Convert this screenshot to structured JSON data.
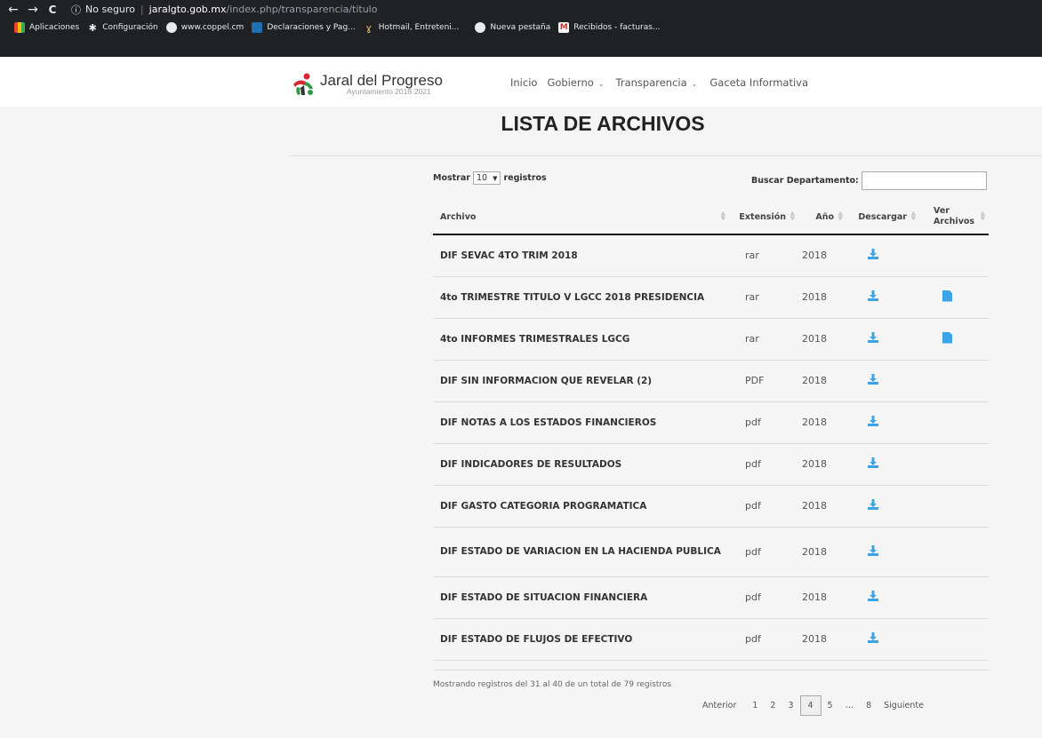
{
  "browser": {
    "back": "←",
    "forward": "→",
    "reload": "C",
    "security_label": "No seguro",
    "url_host": "jaralgto.gob.mx",
    "url_path": "/index.php/transparencia/titulo"
  },
  "bookmarks": [
    {
      "label": "Aplicaciones",
      "icon": "apps-grid-icon"
    },
    {
      "label": "Configuración",
      "icon": "gear-icon"
    },
    {
      "label": "www.coppel.cm",
      "icon": "globe-icon"
    },
    {
      "label": "Declaraciones y Pag...",
      "icon": "sat-icon"
    },
    {
      "label": "Hotmail, Entreteni...",
      "icon": "msn-icon"
    },
    {
      "label": "Nueva pestaña",
      "icon": "globe-icon"
    },
    {
      "label": "Recibidos - facturas...",
      "icon": "gmail-icon"
    }
  ],
  "site": {
    "logo_title": "Jaral del Progreso",
    "logo_sub": "Ayuntamiento 2018-2021",
    "nav": [
      {
        "label": "Inicio",
        "dropdown": false
      },
      {
        "label": "Gobierno",
        "dropdown": true
      },
      {
        "label": "Transparencia",
        "dropdown": true
      },
      {
        "label": "Gaceta Informativa",
        "dropdown": false
      }
    ]
  },
  "page_title": "LISTA DE ARCHIVOS",
  "controls": {
    "show_prefix": "Mostrar",
    "show_value": "10",
    "show_suffix": "registros",
    "search_label": "Buscar Departamento:",
    "search_value": ""
  },
  "table": {
    "headers": [
      "Archivo",
      "Extensión",
      "Año",
      "Descargar",
      "Ver Archivos"
    ],
    "rows": [
      {
        "name": "DIF SEVAC 4TO TRIM 2018",
        "ext": "rar",
        "year": "2018",
        "view": false
      },
      {
        "name": "4to TRIMESTRE TITULO V LGCC 2018 PRESIDENCIA",
        "ext": "rar",
        "year": "2018",
        "view": true
      },
      {
        "name": "4to INFORMES TRIMESTRALES LGCG",
        "ext": "rar",
        "year": "2018",
        "view": true
      },
      {
        "name": "DIF SIN INFORMACION QUE REVELAR (2)",
        "ext": "PDF",
        "year": "2018",
        "view": false
      },
      {
        "name": "DIF NOTAS A LOS ESTADOS FINANCIEROS",
        "ext": "pdf",
        "year": "2018",
        "view": false
      },
      {
        "name": "DIF INDICADORES DE RESULTADOS",
        "ext": "pdf",
        "year": "2018",
        "view": false
      },
      {
        "name": "DIF GASTO CATEGORIA PROGRAMATICA",
        "ext": "pdf",
        "year": "2018",
        "view": false
      },
      {
        "name": "DIF ESTADO DE VARIACION EN LA HACIENDA PUBLICA",
        "ext": "pdf",
        "year": "2018",
        "view": false
      },
      {
        "name": "DIF ESTADO DE SITUACION FINANCIERA",
        "ext": "pdf",
        "year": "2018",
        "view": false
      },
      {
        "name": "DIF ESTADO DE FLUJOS DE EFECTIVO",
        "ext": "pdf",
        "year": "2018",
        "view": false
      }
    ]
  },
  "info": "Mostrando registros del 31 al 40 de un total de 79 registros",
  "pagination": {
    "prev": "Anterior",
    "pages": [
      "1",
      "2",
      "3",
      "4",
      "5",
      "…",
      "8"
    ],
    "current": "4",
    "next": "Siguiente"
  },
  "colors": {
    "accent_blue": "#3ba3e6",
    "logo_red": "#d6282e",
    "logo_green": "#2f9a46"
  }
}
